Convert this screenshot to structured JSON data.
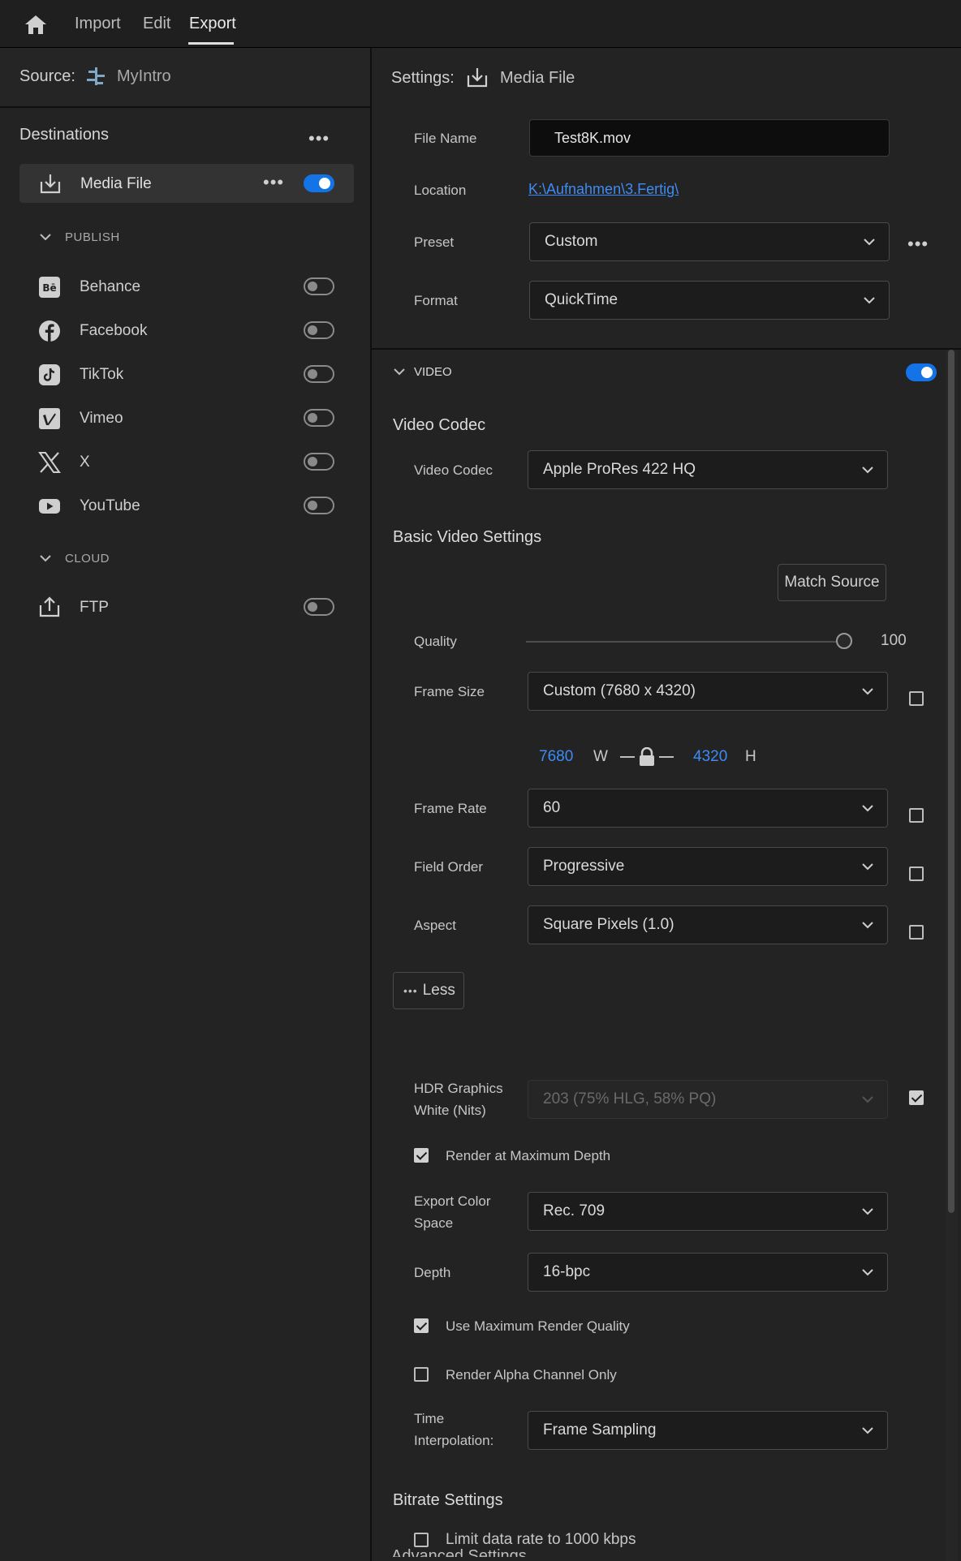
{
  "menu": {
    "import": "Import",
    "edit": "Edit",
    "export": "Export"
  },
  "source": {
    "label": "Source:",
    "name": "MyIntro"
  },
  "destinations": {
    "title": "Destinations",
    "media_file": {
      "label": "Media File",
      "enabled": true
    },
    "publish_header": "PUBLISH",
    "publish": [
      {
        "label": "Behance",
        "icon": "behance-icon",
        "enabled": false
      },
      {
        "label": "Facebook",
        "icon": "facebook-icon",
        "enabled": false
      },
      {
        "label": "TikTok",
        "icon": "tiktok-icon",
        "enabled": false
      },
      {
        "label": "Vimeo",
        "icon": "vimeo-icon",
        "enabled": false
      },
      {
        "label": "X",
        "icon": "x-icon",
        "enabled": false
      },
      {
        "label": "YouTube",
        "icon": "youtube-icon",
        "enabled": false
      }
    ],
    "cloud_header": "CLOUD",
    "cloud": [
      {
        "label": "FTP",
        "icon": "upload-icon",
        "enabled": false
      }
    ]
  },
  "settings": {
    "label": "Settings:",
    "target": "Media File",
    "file_name_label": "File Name",
    "file_name": "Test8K.mov",
    "location_label": "Location",
    "location": "K:\\Aufnahmen\\3.Fertig\\",
    "preset_label": "Preset",
    "preset": "Custom",
    "format_label": "Format",
    "format": "QuickTime"
  },
  "video": {
    "header": "VIDEO",
    "enabled": true,
    "codec_section": "Video Codec",
    "codec_label": "Video Codec",
    "codec": "Apple ProRes 422 HQ",
    "basic_section": "Basic Video Settings",
    "match_source": "Match Source",
    "quality_label": "Quality",
    "quality": "100",
    "frame_size_label": "Frame Size",
    "frame_size": "Custom (7680 x 4320)",
    "width": "7680",
    "w": "W",
    "height": "4320",
    "h": "H",
    "frame_rate_label": "Frame Rate",
    "frame_rate": "60",
    "field_order_label": "Field Order",
    "field_order": "Progressive",
    "aspect_label": "Aspect",
    "aspect": "Square Pixels (1.0)",
    "less_button": "Less",
    "hdr_label_1": "HDR Graphics",
    "hdr_label_2": "White (Nits)",
    "hdr_value": "203 (75% HLG, 58% PQ)",
    "render_max_depth": "Render at Maximum Depth",
    "color_space_label_1": "Export Color",
    "color_space_label_2": "Space",
    "color_space": "Rec. 709",
    "depth_label": "Depth",
    "depth": "16-bpc",
    "max_render_quality": "Use Maximum Render Quality",
    "alpha_only": "Render Alpha Channel Only",
    "time_interp_label_1": "Time",
    "time_interp_label_2": "Interpolation:",
    "time_interp": "Frame Sampling",
    "bitrate_section": "Bitrate Settings",
    "limit_data_rate": "Limit data rate to 1000 kbps",
    "advanced_section": "Advanced Settings"
  },
  "colors": {
    "accent": "#1473e6",
    "link": "#3d8bf5"
  }
}
